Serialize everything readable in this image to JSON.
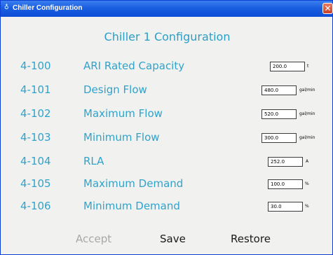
{
  "window": {
    "title": "Chiller Configuration",
    "title_icon": "app-icon",
    "close_icon": "close-icon",
    "close_symbol": "✕"
  },
  "page": {
    "title": "Chiller 1 Configuration"
  },
  "params": [
    {
      "code": "4-100",
      "name": "ARI Rated Capacity",
      "value": "200.0",
      "unit": "t"
    },
    {
      "code": "4-101",
      "name": "Design Flow",
      "value": "480.0",
      "unit": "gal/min"
    },
    {
      "code": "4-102",
      "name": "Maximum Flow",
      "value": "520.0",
      "unit": "gal/min"
    },
    {
      "code": "4-103",
      "name": "Minimum Flow",
      "value": "300.0",
      "unit": "gal/min"
    },
    {
      "code": "4-104",
      "name": "RLA",
      "value": "252.0",
      "unit": "A"
    },
    {
      "code": "4-105",
      "name": "Maximum Demand",
      "value": "100.0",
      "unit": "%"
    },
    {
      "code": "4-106",
      "name": "Minimum Demand",
      "value": "30.0",
      "unit": "%"
    }
  ],
  "actions": {
    "accept_label": "Accept",
    "save_label": "Save",
    "restore_label": "Restore"
  },
  "colors": {
    "titlebar": "#0c4ed6",
    "label": "#2fa3cc",
    "background": "#f1f1ef",
    "disabled": "#a8a8a8"
  }
}
